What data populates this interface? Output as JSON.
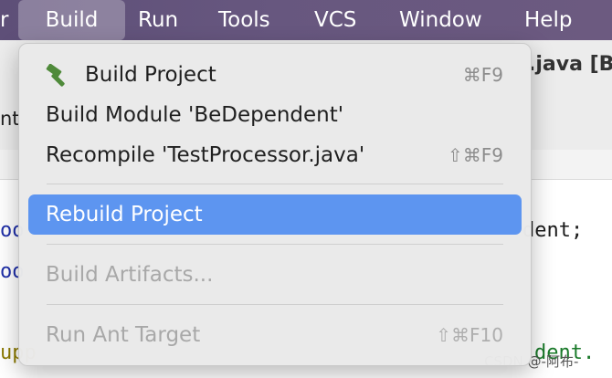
{
  "menubar": {
    "items": [
      {
        "label": "r"
      },
      {
        "label": "Build",
        "active": true
      },
      {
        "label": "Run"
      },
      {
        "label": "Tools"
      },
      {
        "label": "VCS"
      },
      {
        "label": "Window"
      },
      {
        "label": "Help"
      }
    ]
  },
  "background": {
    "title_fragment": ".java [B",
    "toolbar_fragment": "nt",
    "code_lines": [
      "oo",
      "oo",
      "dent;",
      "upp",
      "dent."
    ]
  },
  "build_menu": {
    "items": [
      {
        "label": "Build Project",
        "shortcut": "⌘F9",
        "icon": "hammer-icon",
        "state": "normal"
      },
      {
        "label": "Build Module 'BeDependent'",
        "shortcut": "",
        "state": "normal"
      },
      {
        "label": "Recompile 'TestProcessor.java'",
        "shortcut": "⇧⌘F9",
        "state": "normal"
      },
      {
        "label": "Rebuild Project",
        "shortcut": "",
        "state": "highlighted"
      },
      {
        "label": "Build Artifacts...",
        "shortcut": "",
        "state": "disabled"
      },
      {
        "label": "Run Ant Target",
        "shortcut": "⇧⌘F10",
        "state": "disabled"
      }
    ]
  },
  "watermark": "CSDN @-阿布-",
  "colors": {
    "menubar": "#65557d",
    "highlight": "#5d95f0",
    "hammer": "#4f8a3a"
  }
}
